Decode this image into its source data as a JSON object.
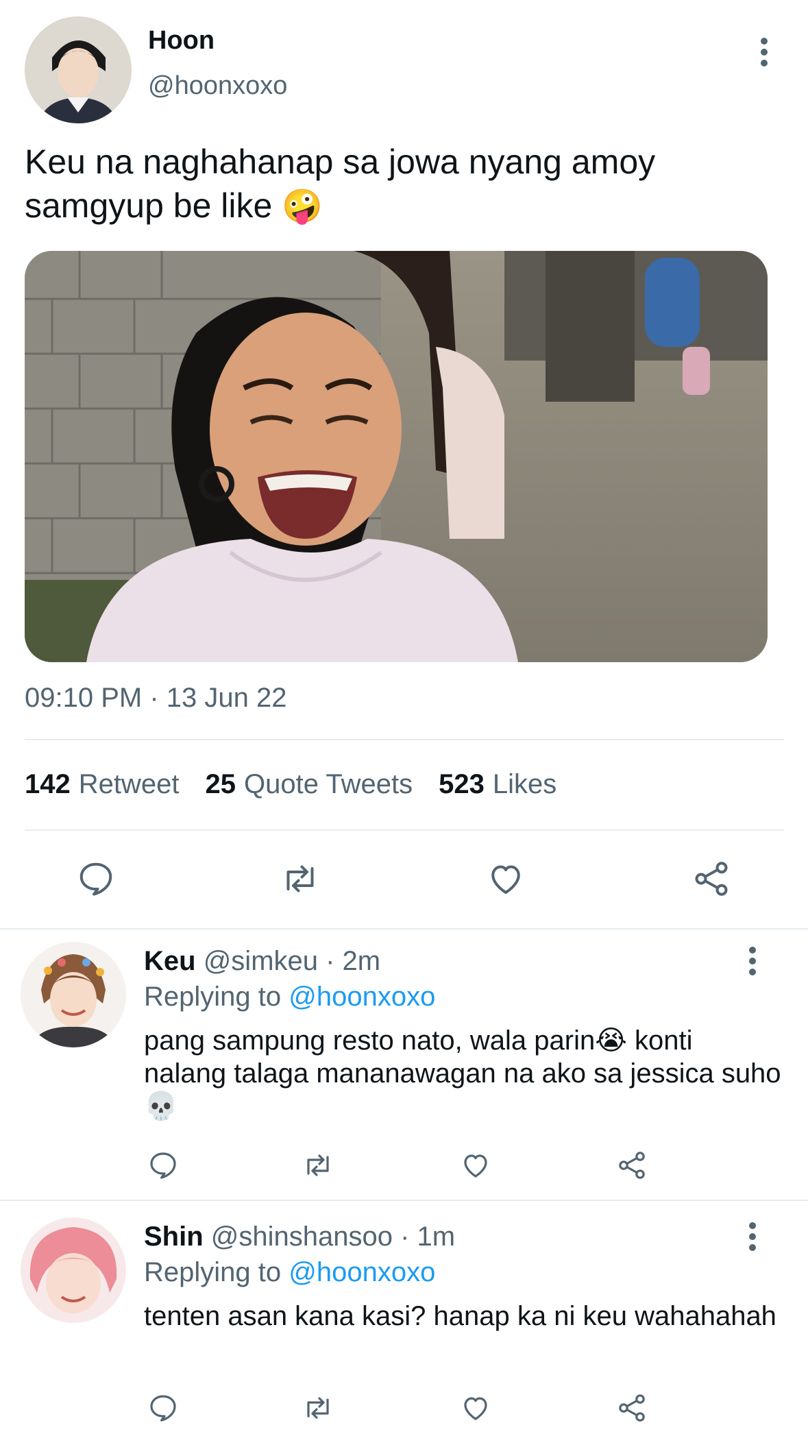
{
  "tweet": {
    "author_name": "Hoon",
    "author_handle": "@hoonxoxo",
    "text": "Keu na naghahanap sa jowa nyang amoy samgyup be like",
    "text_emoji": "🤪",
    "timestamp": "09:10 PM · 13 Jun 22",
    "stats": [
      {
        "count": "142",
        "label": "Retweet"
      },
      {
        "count": "25",
        "label": "Quote Tweets"
      },
      {
        "count": "523",
        "label": "Likes"
      }
    ],
    "actions": [
      "reply-icon",
      "retweet-icon",
      "like-icon",
      "share-icon"
    ]
  },
  "replies": [
    {
      "name": "Keu",
      "meta": "@simkeu · 2m",
      "replying_prefix": "Replying to",
      "replying_to": "@hoonxoxo",
      "text": "pang sampung resto nato, wala parin😭 konti nalang talaga mananawagan na ako sa jessica suho 💀"
    },
    {
      "name": "Shin",
      "meta": "@shinshansoo · 1m",
      "replying_prefix": "Replying to",
      "replying_to": "@hoonxoxo",
      "text": "tenten asan kana kasi? hanap ka ni keu wahahahah"
    }
  ],
  "colors": {
    "text_primary": "#0f1419",
    "text_secondary": "#536471",
    "mention": "#1d9bf0",
    "icon": "#536471",
    "divider": "#e6ecf0"
  }
}
